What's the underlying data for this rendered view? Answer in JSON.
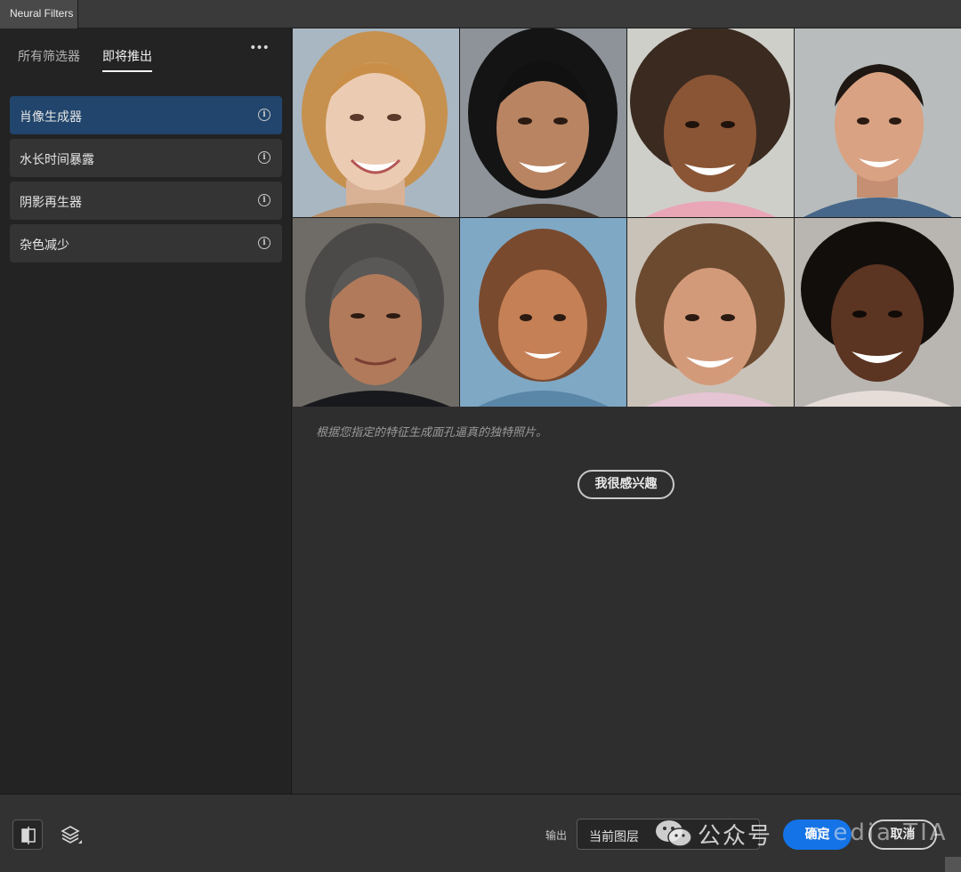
{
  "window": {
    "title": "Neural Filters"
  },
  "sidebar": {
    "tabs": [
      {
        "label": "所有筛选器",
        "active": false
      },
      {
        "label": "即将推出",
        "active": true
      }
    ],
    "more_icon": "ellipsis-icon",
    "filters": [
      {
        "label": "肖像生成器",
        "selected": true,
        "icon": "info-icon"
      },
      {
        "label": "水长时间暴露",
        "selected": false,
        "icon": "info-icon"
      },
      {
        "label": "阴影再生器",
        "selected": false,
        "icon": "info-icon"
      },
      {
        "label": "杂色减少",
        "selected": false,
        "icon": "info-icon"
      }
    ]
  },
  "preview": {
    "images": [
      "portrait-blonde-woman",
      "portrait-long-black-hair-man",
      "portrait-curly-woman",
      "portrait-young-man-blue-shirt",
      "portrait-older-man",
      "portrait-girl-blue-background",
      "portrait-smiling-woman",
      "portrait-curly-man"
    ],
    "description": "根据您指定的特征生成面孔逼真的独特照片。",
    "interest_button": "我很感兴趣"
  },
  "footer": {
    "compare_icon": "split-view-icon",
    "layers_icon": "layers-icon",
    "output_label": "输出",
    "output_value": "当前图层",
    "ok_label": "确定",
    "cancel_label": "取消",
    "watermark_text": "公众号",
    "watermark_latin": "media TIA"
  },
  "colors": {
    "accent": "#1473e6",
    "selected_item": "#21456c",
    "panel_bg": "#232323",
    "main_bg": "#2e2e2e"
  }
}
